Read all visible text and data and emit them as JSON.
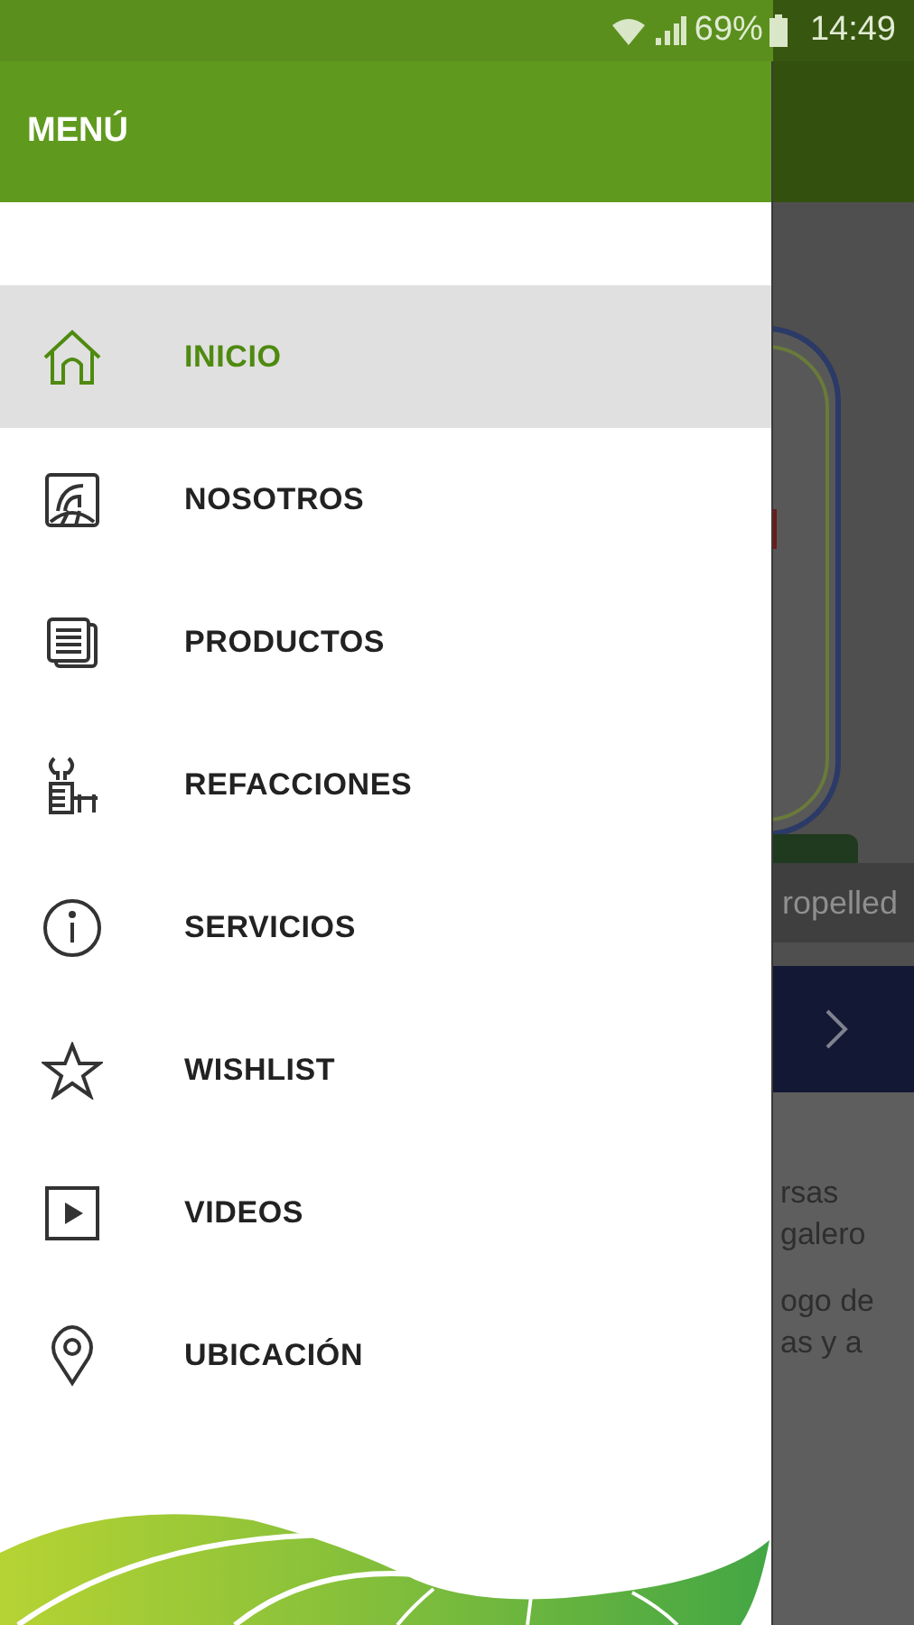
{
  "status_bar": {
    "battery": "69%",
    "time": "14:49"
  },
  "drawer": {
    "title": "MENÚ",
    "items": [
      {
        "label": "INICIO",
        "selected": true
      },
      {
        "label": "NOSOTROS",
        "selected": false
      },
      {
        "label": "PRODUCTOS",
        "selected": false
      },
      {
        "label": "REFACCIONES",
        "selected": false
      },
      {
        "label": "SERVICIOS",
        "selected": false
      },
      {
        "label": "WISHLIST",
        "selected": false
      },
      {
        "label": "VIDEOS",
        "selected": false
      },
      {
        "label": "UBICACIÓN",
        "selected": false
      }
    ]
  },
  "background": {
    "caption": "ropelled",
    "paragraphs": [
      [
        "rsas",
        "galero"
      ],
      [
        "ogo de",
        "as y a"
      ]
    ]
  }
}
